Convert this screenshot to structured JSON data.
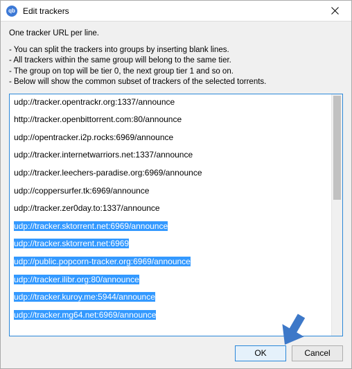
{
  "window": {
    "title": "Edit trackers",
    "app_icon_label": "qb"
  },
  "instructions": {
    "lead": "One tracker URL per line.",
    "lines": [
      "- You can split the trackers into groups by inserting blank lines.",
      "- All trackers within the same group will belong to the same tier.",
      "- The group on top will be tier 0, the next group tier 1 and so on.",
      "- Below will show the common subset of trackers of the selected torrents."
    ]
  },
  "trackers": {
    "unselected": [
      "udp://tracker.opentrackr.org:1337/announce",
      "http://tracker.openbittorrent.com:80/announce",
      "udp://opentracker.i2p.rocks:6969/announce",
      "udp://tracker.internetwarriors.net:1337/announce",
      "udp://tracker.leechers-paradise.org:6969/announce",
      "udp://coppersurfer.tk:6969/announce",
      "udp://tracker.zer0day.to:1337/announce"
    ],
    "selected": [
      "udp://tracker.sktorrent.net:6969/announce",
      "udp://tracker.sktorrent.net:6969",
      "udp://public.popcorn-tracker.org:6969/announce",
      "udp://tracker.ilibr.org:80/announce",
      "udp://tracker.kuroy.me:5944/announce",
      "udp://tracker.mg64.net:6969/announce"
    ]
  },
  "buttons": {
    "ok": "OK",
    "cancel": "Cancel"
  },
  "annotation": {
    "arrow_color": "#3d78c8"
  }
}
